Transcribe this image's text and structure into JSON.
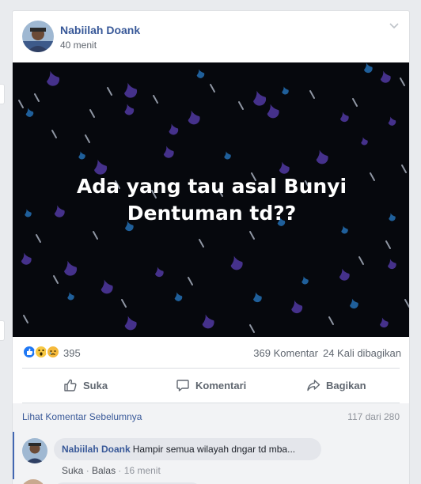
{
  "post": {
    "author": "Nabiilah Doank",
    "time": "40 menit",
    "image_text": "Ada yang tau asal Bunyi Dentuman td??",
    "reaction_icons": [
      "like-icon",
      "wow-icon",
      "sad-icon"
    ],
    "reaction_count": "395",
    "comment_count": "369 Komentar",
    "share_count": "24 Kali dibagikan"
  },
  "actions": {
    "like": "Suka",
    "comment": "Komentari",
    "share": "Bagikan"
  },
  "comments": {
    "previous_link": "Lihat Komentar Sebelumnya",
    "page_count": "117 dari 280",
    "items": [
      {
        "author": "Nabiilah Doank",
        "text": "Hampir semua wilayah dngar td mba...",
        "like": "Suka",
        "reply": "Balas",
        "time": "16 menit"
      }
    ]
  },
  "colors": {
    "link": "#385898",
    "media_bg": "#06080d",
    "drop_blue": "#1f5f9a",
    "drop_purple": "#45318b"
  }
}
